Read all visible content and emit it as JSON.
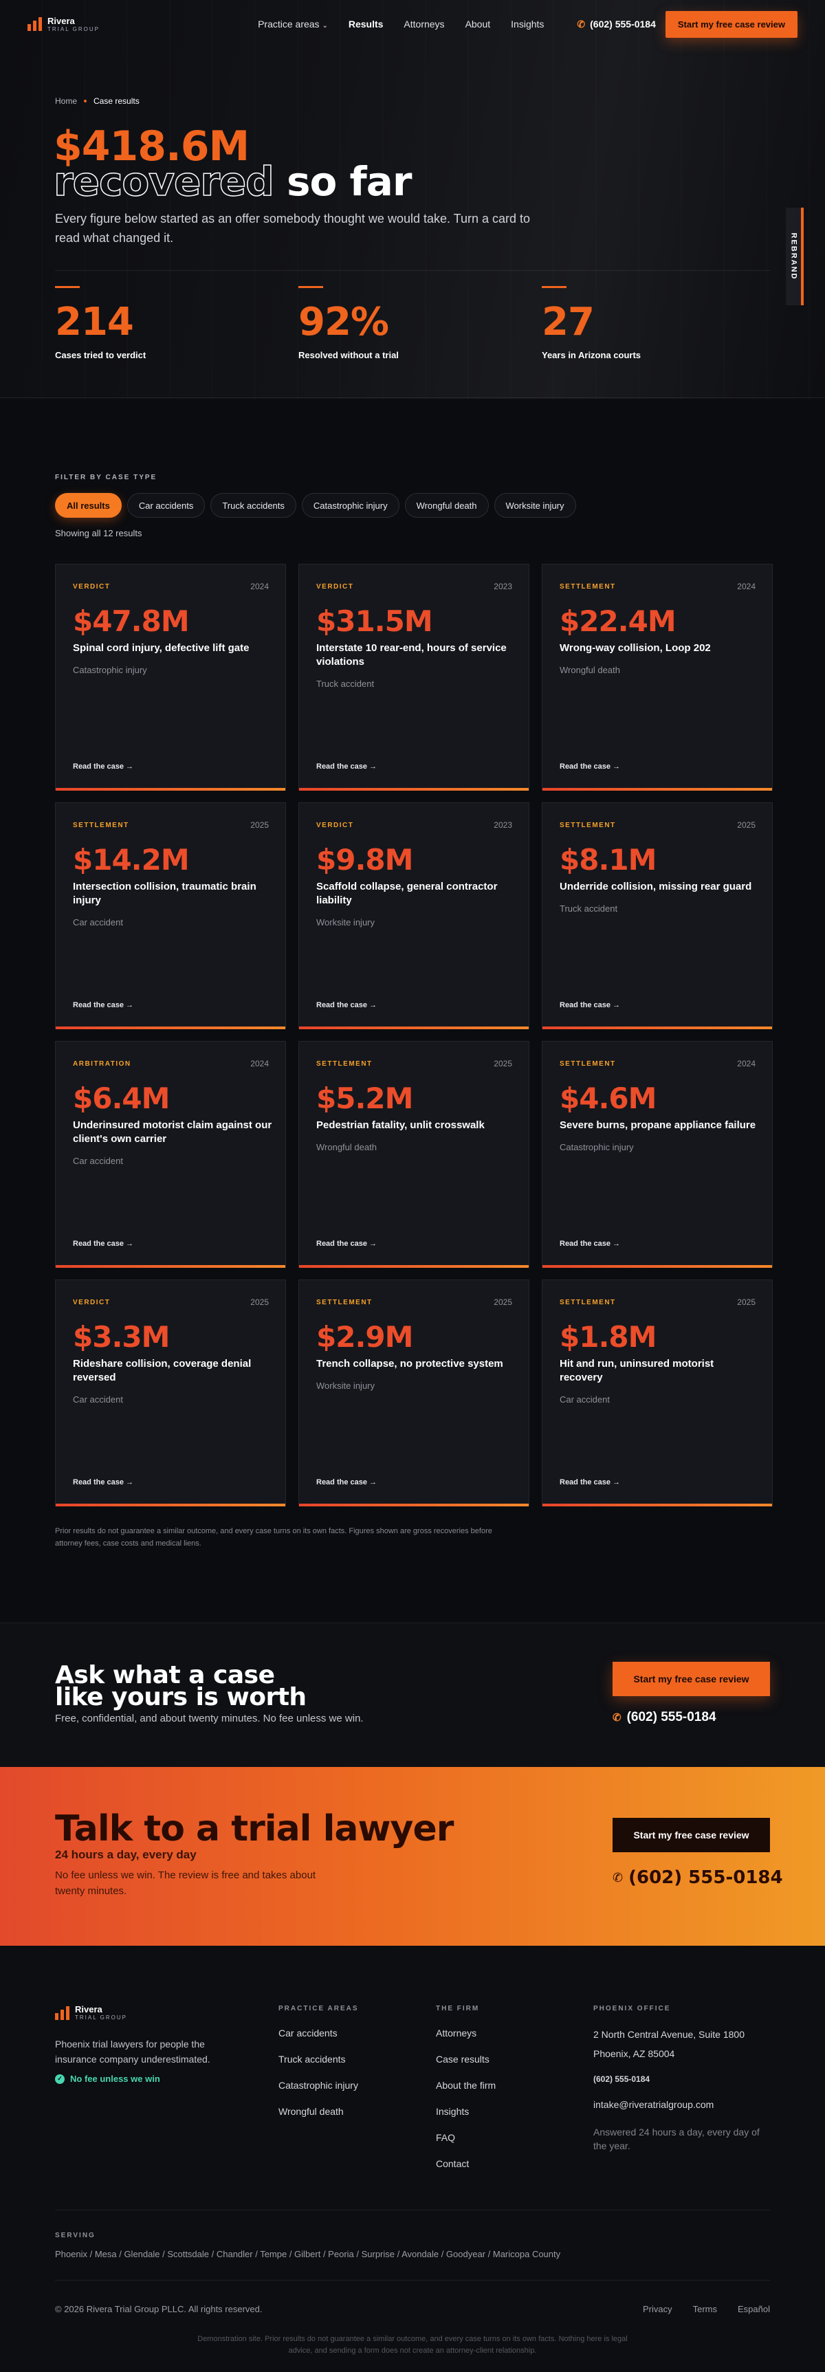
{
  "brand": {
    "name": "Rivera",
    "sub": "TRIAL GROUP"
  },
  "nav": {
    "items": [
      "Practice areas",
      "Results",
      "Attorneys",
      "About",
      "Insights"
    ],
    "active": "Results",
    "phone": "(602) 555-0184",
    "cta": "Start my free case review"
  },
  "hero": {
    "crumb_home": "Home",
    "crumb_current": "Case results",
    "amount": "$418.6M",
    "line2_outline": "recovered",
    "line2_solid": "so far",
    "sub": "Every figure below started as an offer somebody thought we would take. Turn a card to read what changed it.",
    "badge": "REBRAND"
  },
  "stats": [
    {
      "num": "214",
      "label": "Cases tried to verdict"
    },
    {
      "num": "92%",
      "label": "Resolved without a trial"
    },
    {
      "num": "27",
      "label": "Years in Arizona courts"
    }
  ],
  "filter": {
    "label": "FILTER BY CASE TYPE",
    "chips": [
      "All results",
      "Car accidents",
      "Truck accidents",
      "Catastrophic injury",
      "Wrongful death",
      "Worksite injury"
    ],
    "count": "Showing all 12 results"
  },
  "read_label": "Read the case",
  "cards": [
    {
      "tag": "VERDICT",
      "year": "2024",
      "amount": "$47.8M",
      "title": "Spinal cord injury, defective lift gate",
      "type": "Catastrophic injury"
    },
    {
      "tag": "VERDICT",
      "year": "2023",
      "amount": "$31.5M",
      "title": "Interstate 10 rear-end, hours of service violations",
      "type": "Truck accident"
    },
    {
      "tag": "SETTLEMENT",
      "year": "2024",
      "amount": "$22.4M",
      "title": "Wrong-way collision, Loop 202",
      "type": "Wrongful death"
    },
    {
      "tag": "SETTLEMENT",
      "year": "2025",
      "amount": "$14.2M",
      "title": "Intersection collision, traumatic brain injury",
      "type": "Car accident"
    },
    {
      "tag": "VERDICT",
      "year": "2023",
      "amount": "$9.8M",
      "title": "Scaffold collapse, general contractor liability",
      "type": "Worksite injury"
    },
    {
      "tag": "SETTLEMENT",
      "year": "2025",
      "amount": "$8.1M",
      "title": "Underride collision, missing rear guard",
      "type": "Truck accident"
    },
    {
      "tag": "ARBITRATION",
      "year": "2024",
      "amount": "$6.4M",
      "title": "Underinsured motorist claim against our client's own carrier",
      "type": "Car accident"
    },
    {
      "tag": "SETTLEMENT",
      "year": "2025",
      "amount": "$5.2M",
      "title": "Pedestrian fatality, unlit crosswalk",
      "type": "Wrongful death"
    },
    {
      "tag": "SETTLEMENT",
      "year": "2024",
      "amount": "$4.6M",
      "title": "Severe burns, propane appliance failure",
      "type": "Catastrophic injury"
    },
    {
      "tag": "VERDICT",
      "year": "2025",
      "amount": "$3.3M",
      "title": "Rideshare collision, coverage denial reversed",
      "type": "Car accident"
    },
    {
      "tag": "SETTLEMENT",
      "year": "2025",
      "amount": "$2.9M",
      "title": "Trench collapse, no protective system",
      "type": "Worksite injury"
    },
    {
      "tag": "SETTLEMENT",
      "year": "2025",
      "amount": "$1.8M",
      "title": "Hit and run, uninsured motorist recovery",
      "type": "Car accident"
    }
  ],
  "disclaimer": "Prior results do not guarantee a similar outcome, and every case turns on its own facts. Figures shown are gross recoveries before attorney fees, case costs and medical liens.",
  "band1": {
    "title1": "Ask what a case",
    "title2": "like yours is worth",
    "sub": "Free, confidential, and about twenty minutes. No fee unless we win.",
    "cta": "Start my free case review",
    "phone": "(602) 555-0184"
  },
  "band2": {
    "title": "Talk to a trial lawyer",
    "s1": "24 hours a day, every day",
    "s2": "No fee unless we win. The review is free and takes about twenty minutes.",
    "cta": "Start my free case review",
    "phone": "(602) 555-0184"
  },
  "footer": {
    "tagline": "Phoenix trial lawyers for people the insurance company underestimated.",
    "nofee": "No fee unless we win",
    "practice": {
      "h": "PRACTICE AREAS",
      "items": [
        "Car accidents",
        "Truck accidents",
        "Catastrophic injury",
        "Wrongful death"
      ]
    },
    "firm": {
      "h": "THE FIRM",
      "items": [
        "Attorneys",
        "Case results",
        "About the firm",
        "Insights",
        "FAQ",
        "Contact"
      ]
    },
    "office": {
      "h": "PHOENIX OFFICE",
      "street": "2 North Central Avenue, Suite 1800",
      "city": "Phoenix, AZ 85004",
      "phone": "(602) 555-0184",
      "email": "intake@riveratrialgroup.com",
      "hours": "Answered 24 hours a day, every day of the year."
    },
    "serving_label": "SERVING",
    "serving": "Phoenix / Mesa / Glendale / Scottsdale / Chandler / Tempe / Gilbert / Peoria / Surprise / Avondale / Goodyear / Maricopa County",
    "copyright": "© 2026 Rivera Trial Group PLLC. All rights reserved.",
    "links": [
      "Privacy",
      "Terms",
      "Español"
    ],
    "demo": "Demonstration site. Prior results do not guarantee a similar outcome, and every case turns on its own facts. Nothing here is legal advice, and sending a form does not create an attorney-client relationship."
  }
}
